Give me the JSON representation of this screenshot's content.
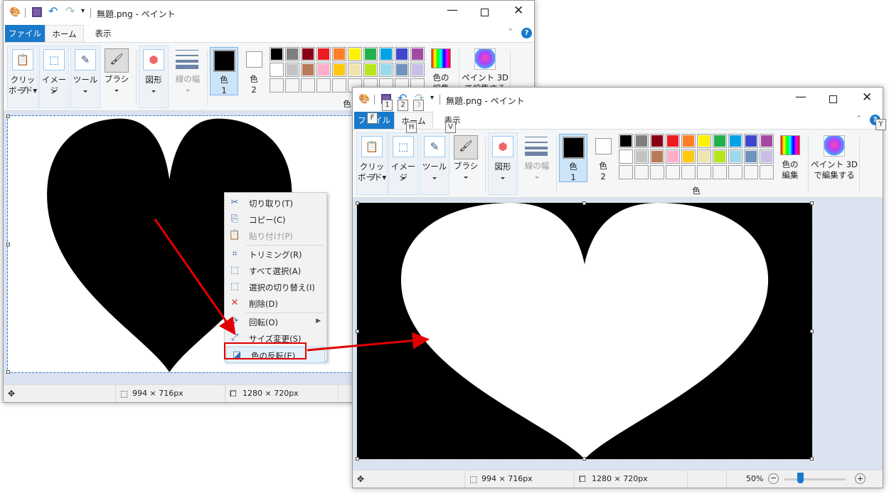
{
  "window": {
    "title": "無題.png - ペイント",
    "tabs": [
      "ファイル",
      "ホーム",
      "表示"
    ],
    "ribbon": {
      "clipboard": [
        "クリップ",
        "ボード▾"
      ],
      "image": "イメージ",
      "tools": "ツール",
      "brushes": "ブラシ",
      "shapes": "図形",
      "size": "線の幅",
      "color1": [
        "色",
        "1"
      ],
      "color2": [
        "色",
        "2"
      ],
      "colors_group": "色",
      "edit_colors": [
        "色の",
        "編集"
      ],
      "paint3d": [
        "ペイント 3D",
        "で編集する"
      ]
    },
    "palette": [
      [
        "#000000",
        "#7f7f7f",
        "#880015",
        "#ed1c24",
        "#ff7f27",
        "#fff200",
        "#22b14c",
        "#00a2e8",
        "#3f48cc",
        "#a349a4"
      ],
      [
        "#ffffff",
        "#c3c3c3",
        "#b97a57",
        "#ffaec9",
        "#ffc90e",
        "#efe4b0",
        "#b5e61d",
        "#99d9ea",
        "#7092be",
        "#c8bfe7"
      ]
    ],
    "status": {
      "selection": "994 × 716px",
      "canvas": "1280 × 720px",
      "zoom": "50%"
    },
    "zoom_level": 0.5,
    "accent": "#1979ca"
  },
  "context_menu": [
    {
      "label": "切り取り(T)",
      "icon": "scissors-icon"
    },
    {
      "label": "コピー(C)",
      "icon": "copy-icon"
    },
    {
      "label": "貼り付け(P)",
      "icon": "paste-icon",
      "disabled": true
    },
    {
      "label": "トリミング(R)",
      "icon": "crop-icon"
    },
    {
      "label": "すべて選択(A)",
      "icon": "select-all-icon"
    },
    {
      "label": "選択の切り替え(I)",
      "icon": "invert-selection-icon"
    },
    {
      "label": "削除(D)",
      "icon": "delete-icon"
    },
    {
      "label": "回転(O)",
      "icon": "rotate-icon",
      "submenu": true
    },
    {
      "label": "サイズ変更(S)",
      "icon": "resize-icon"
    },
    {
      "label": "色の反転(E)",
      "icon": "invert-color-icon",
      "highlighted": true
    }
  ],
  "keytips": {
    "qat": [
      "1",
      "2",
      "3"
    ],
    "file": "F",
    "home": "H",
    "view": "V",
    "help": "Y"
  },
  "highlight_color": "#e00000"
}
